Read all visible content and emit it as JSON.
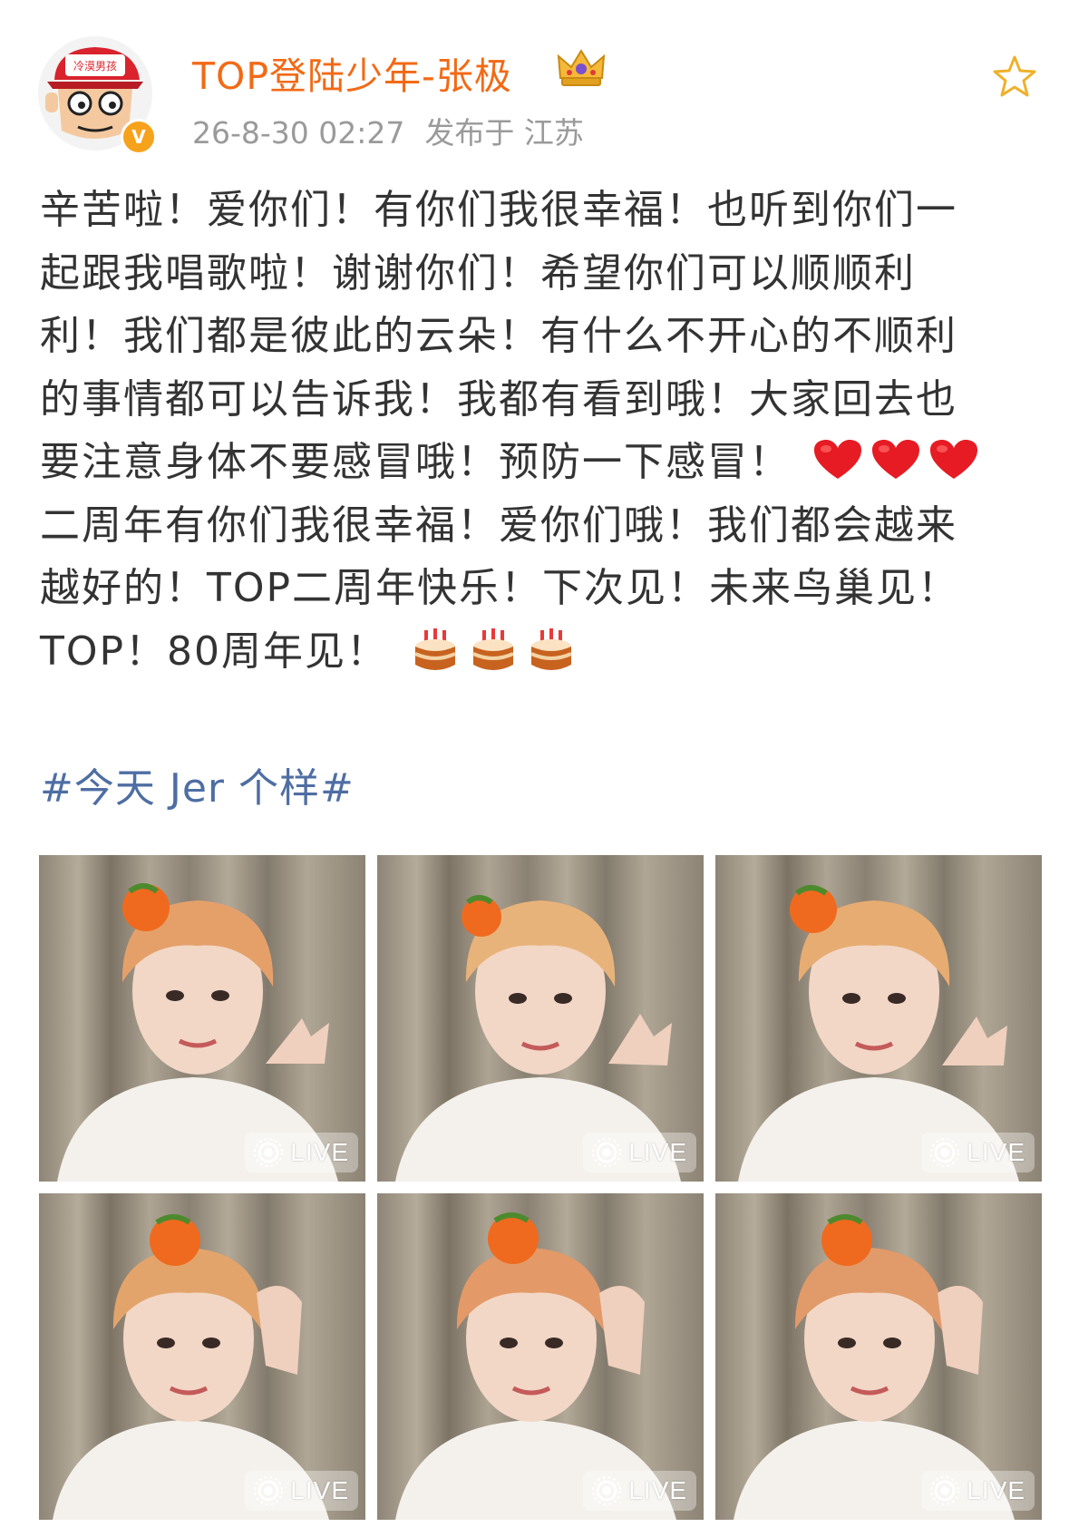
{
  "header": {
    "username": "TOP登陆少年-张极",
    "timestamp": "26-8-30 02:27",
    "location": "发布于 江苏",
    "avatar_caption": "冷漠男孩",
    "verified_mark": "V",
    "favorite_icon": "star-outline-icon",
    "badge_icon": "crown-icon"
  },
  "post": {
    "lines": [
      "辛苦啦！爱你们！有你们我很幸福！也听到你们一",
      "起跟我唱歌啦！谢谢你们！希望你们可以顺顺利",
      "利！我们都是彼此的云朵！有什么不开心的不顺利",
      "的事情都可以告诉我！我都有看到哦！大家回去也",
      "要注意身体不要感冒哦！预防一下感冒！",
      "二周年有你们我很幸福！爱你们哦！我们都会越来",
      "越好的！TOP二周年快乐！下次见！未来鸟巢见！",
      "TOP！80周年见！"
    ],
    "line5_emoji": "heart-emoji",
    "line8_emoji": "cake-emoji",
    "hashtag": "#今天 Jer 个样#"
  },
  "photos": [
    {
      "live_label": "LIVE"
    },
    {
      "live_label": "LIVE"
    },
    {
      "live_label": "LIVE"
    },
    {
      "live_label": "LIVE"
    },
    {
      "live_label": "LIVE"
    },
    {
      "live_label": "LIVE"
    }
  ],
  "colors": {
    "username": "#f26a16",
    "meta": "#9a9a9a",
    "hashtag": "#4e6ea3",
    "verified": "#f7a21b"
  }
}
